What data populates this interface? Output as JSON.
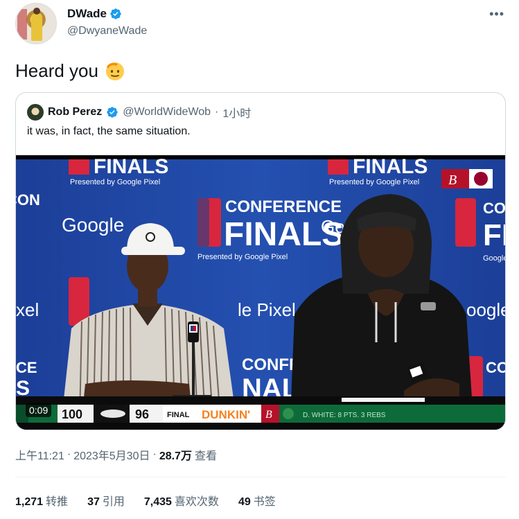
{
  "author": {
    "display_name": "DWade",
    "handle": "@DwyaneWade"
  },
  "tweet": {
    "text": "Heard you",
    "emoji_icon": "saluting-face-emoji"
  },
  "quoted": {
    "display_name": "Rob Perez",
    "handle": "@WorldWideWob",
    "separator": "·",
    "time": "1小时",
    "text": "it was, in fact, the same situation.",
    "video": {
      "duration": "0:09",
      "backdrop_text": {
        "finals_top": "FINALS",
        "presented_by": "Presented by Google Pixel",
        "conference": "CONFERENCE",
        "finals": "FINALS",
        "google": "Google",
        "google_pixel": "Google Pixel",
        "pixel_fragment": "le Pixel",
        "xel_fragment": "xel",
        "oogle_fragment": "oogle",
        "conf_fragment": "CON"
      },
      "scoreboard": {
        "score_left": "100",
        "score_right": "96",
        "status": "FINAL",
        "sponsor": "DUNKIN'",
        "ticker": "D. WHITE: 8 PTS. 3 REBS"
      }
    }
  },
  "meta": {
    "time": "上午11:21",
    "sep1": "·",
    "date": "2023年5月30日",
    "sep2": "·",
    "views": "28.7万",
    "views_label": "查看"
  },
  "stats": [
    {
      "value": "1,271",
      "label": "转推"
    },
    {
      "value": "37",
      "label": "引用"
    },
    {
      "value": "7,435",
      "label": "喜欢次数"
    },
    {
      "value": "49",
      "label": "书签"
    }
  ],
  "colors": {
    "verified": "#1d9bf0",
    "text_secondary": "#536471",
    "backdrop_blue": "#1d3f94",
    "scoreboard_green": "#0d6b3a"
  }
}
